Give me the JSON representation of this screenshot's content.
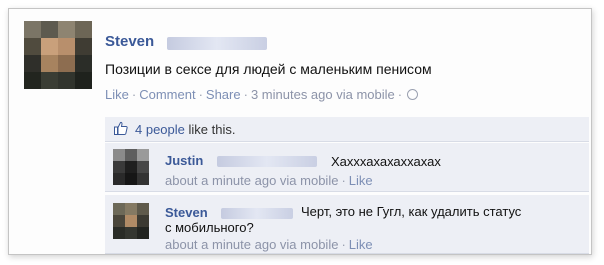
{
  "post": {
    "author": "Steven",
    "text": "Позиции в сексе для людей с маленьким пенисом",
    "actions": {
      "like": "Like",
      "comment": "Comment",
      "share": "Share"
    },
    "time": "3 minutes ago via mobile"
  },
  "likes": {
    "count_link": "4 people",
    "suffix": " like this."
  },
  "comments": [
    {
      "author": "Justin",
      "text": "Хахххахахаххахах",
      "time": "about a minute ago via mobile",
      "like": "Like"
    },
    {
      "author": "Steven",
      "text_line1": "Черт, это не Гугл, как удалить статус",
      "text_line2": "с мобильного?",
      "time": "about a minute ago via mobile",
      "like": "Like"
    }
  ],
  "colors": {
    "link": "#3b5998",
    "meta": "#8c93a8",
    "comment_bg": "#edeff5"
  },
  "icons": [
    "thumbs-up-icon",
    "globe-icon"
  ]
}
